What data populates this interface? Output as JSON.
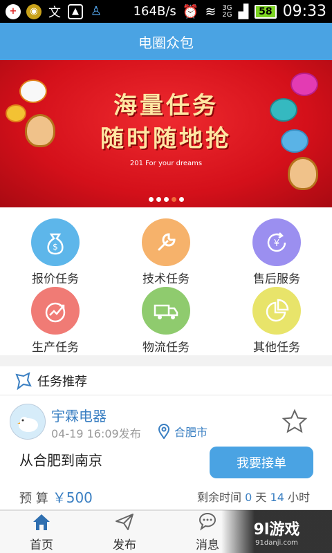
{
  "status_bar": {
    "speed": "164B/s",
    "network_top": "3G",
    "network_bottom": "2G",
    "battery": "58",
    "time": "09:33"
  },
  "app": {
    "title": "电圈众包"
  },
  "banner": {
    "headline": "海量任务",
    "subline": "随时随地抢",
    "tagline": "201  For your dreams",
    "slide_count": 5,
    "active_slide": 4
  },
  "categories": [
    {
      "label": "报价任务",
      "color": "#5db6ea",
      "icon": "money-bag-icon"
    },
    {
      "label": "技术任务",
      "color": "#f6b26b",
      "icon": "wrench-icon"
    },
    {
      "label": "售后服务",
      "color": "#9b8ff0",
      "icon": "yuan-refresh-icon"
    },
    {
      "label": "生产任务",
      "color": "#f07b75",
      "icon": "growth-chart-icon"
    },
    {
      "label": "物流任务",
      "color": "#8fcb6e",
      "icon": "truck-icon"
    },
    {
      "label": "其他任务",
      "color": "#e8e46a",
      "icon": "pie-chart-icon"
    }
  ],
  "recommend": {
    "title": "任务推荐"
  },
  "task": {
    "company": "宇霖电器",
    "posted": "04-19 16:09发布",
    "city": "合肥市",
    "route": "从合肥到南京",
    "accept_label": "我要接单",
    "budget_label": "预 算",
    "budget_value": "￥500",
    "remaining_prefix": "剩余时间",
    "remaining_days": "0",
    "remaining_days_unit": "天",
    "remaining_hours": "14",
    "remaining_hours_unit": "小时"
  },
  "nav": [
    {
      "label": "首页",
      "icon": "home-icon",
      "active": true
    },
    {
      "label": "发布",
      "icon": "paper-plane-icon",
      "active": false
    },
    {
      "label": "消息",
      "icon": "chat-bubble-icon",
      "active": false
    }
  ],
  "watermark": {
    "main": "9l游戏",
    "sub": "91danji.com"
  },
  "colors": {
    "primary": "#4aa3e3",
    "banner_red": "#d4101a"
  }
}
